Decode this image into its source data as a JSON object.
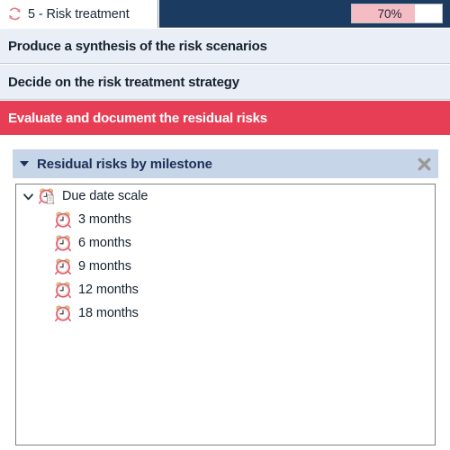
{
  "topbar": {
    "icon": "cycle-refresh-icon",
    "tab_label": "5 - Risk treatment",
    "progress_value": "70%",
    "progress_percent": 70,
    "navy_color": "#1b3c60",
    "progress_fill_color": "#f6bcc4"
  },
  "task_rows": [
    {
      "label": "Produce a synthesis of the risk scenarios",
      "style": "light"
    },
    {
      "label": "Decide on the risk treatment strategy",
      "style": "light"
    },
    {
      "label": "Evaluate and document the residual risks",
      "style": "accent"
    }
  ],
  "panel": {
    "title": "Residual risks by milestone",
    "collapse_icon": "caret-down-icon",
    "close_icon": "close-x-icon",
    "header_color": "#c6d5e8",
    "title_color": "#1b3055"
  },
  "tree": {
    "root": {
      "label": "Due date scale",
      "icon": "alarm-clock-document-icon",
      "expander": "chevron-down-icon",
      "expanded": true
    },
    "children": [
      {
        "label": "3 months",
        "icon": "alarm-clock-icon"
      },
      {
        "label": "6 months",
        "icon": "alarm-clock-icon"
      },
      {
        "label": "9 months",
        "icon": "alarm-clock-icon"
      },
      {
        "label": "12 months",
        "icon": "alarm-clock-icon"
      },
      {
        "label": "18 months",
        "icon": "alarm-clock-icon"
      }
    ]
  },
  "colors": {
    "accent_red": "#e83e55",
    "row_light": "#e9eef7",
    "text_dark": "#16232f"
  }
}
